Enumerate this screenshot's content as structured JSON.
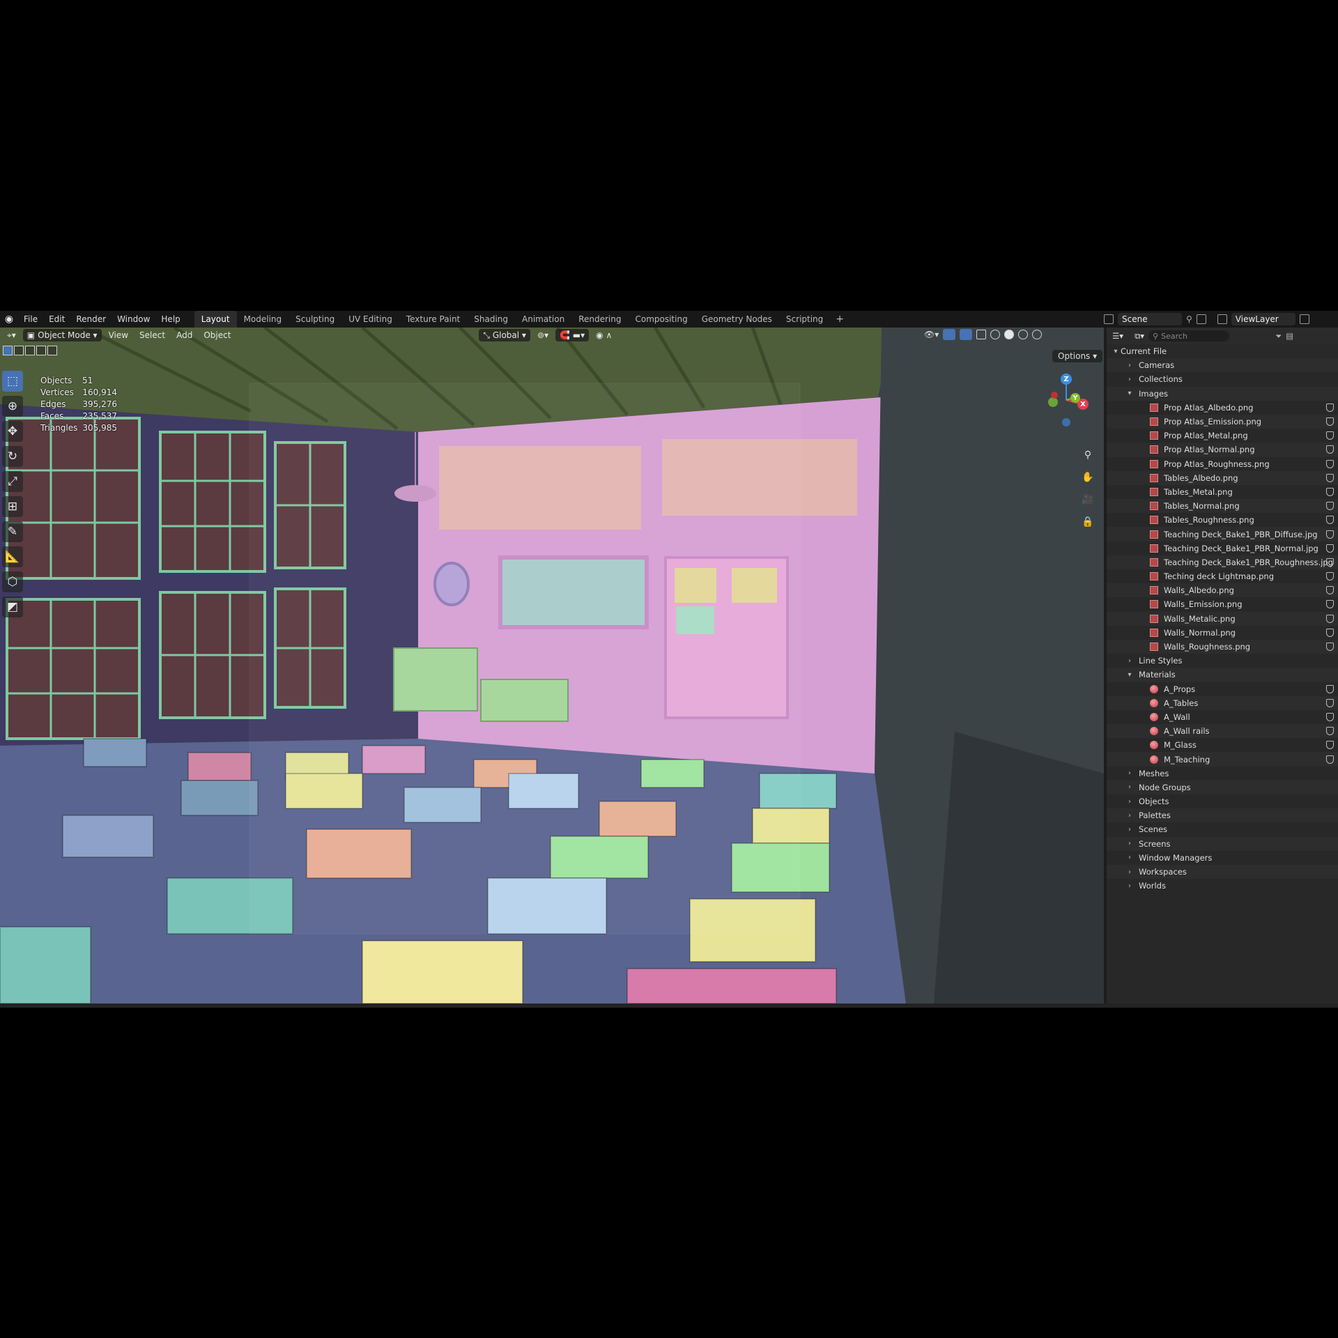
{
  "menu": [
    "File",
    "Edit",
    "Render",
    "Window",
    "Help"
  ],
  "workspaces": [
    "Layout",
    "Modeling",
    "Sculpting",
    "UV Editing",
    "Texture Paint",
    "Shading",
    "Animation",
    "Rendering",
    "Compositing",
    "Geometry Nodes",
    "Scripting"
  ],
  "active_workspace": "Layout",
  "scene_name": "Scene",
  "view_layer": "ViewLayer",
  "viewport": {
    "mode": "Object Mode",
    "menus": [
      "View",
      "Select",
      "Add",
      "Object"
    ],
    "orientation": "Global",
    "options_label": "Options",
    "stats": [
      {
        "label": "Objects",
        "value": "51"
      },
      {
        "label": "Vertices",
        "value": "160,914"
      },
      {
        "label": "Edges",
        "value": "395,276"
      },
      {
        "label": "Faces",
        "value": "235,537"
      },
      {
        "label": "Triangles",
        "value": "305,985"
      }
    ],
    "axes": {
      "z": "Z",
      "y": "Y",
      "x": "X"
    }
  },
  "outliner": {
    "search_placeholder": "Search",
    "root": "Current File",
    "rows": [
      {
        "label": "Cameras",
        "type": "group",
        "expanded": false
      },
      {
        "label": "Collections",
        "type": "group",
        "expanded": false
      },
      {
        "label": "Images",
        "type": "group",
        "expanded": true
      },
      {
        "label": "Prop Atlas_Albedo.png",
        "type": "image"
      },
      {
        "label": "Prop Atlas_Emission.png",
        "type": "image"
      },
      {
        "label": "Prop Atlas_Metal.png",
        "type": "image"
      },
      {
        "label": "Prop Atlas_Normal.png",
        "type": "image"
      },
      {
        "label": "Prop Atlas_Roughness.png",
        "type": "image"
      },
      {
        "label": "Tables_Albedo.png",
        "type": "image"
      },
      {
        "label": "Tables_Metal.png",
        "type": "image"
      },
      {
        "label": "Tables_Normal.png",
        "type": "image"
      },
      {
        "label": "Tables_Roughness.png",
        "type": "image"
      },
      {
        "label": "Teaching Deck_Bake1_PBR_Diffuse.jpg",
        "type": "image"
      },
      {
        "label": "Teaching Deck_Bake1_PBR_Normal.jpg",
        "type": "image"
      },
      {
        "label": "Teaching Deck_Bake1_PBR_Roughness.jpg",
        "type": "image"
      },
      {
        "label": "Teching deck Lightmap.png",
        "type": "image"
      },
      {
        "label": "Walls_Albedo.png",
        "type": "image"
      },
      {
        "label": "Walls_Emission.png",
        "type": "image"
      },
      {
        "label": "Walls_Metalic.png",
        "type": "image"
      },
      {
        "label": "Walls_Normal.png",
        "type": "image"
      },
      {
        "label": "Walls_Roughness.png",
        "type": "image"
      },
      {
        "label": "Line Styles",
        "type": "group",
        "expanded": false
      },
      {
        "label": "Materials",
        "type": "group",
        "expanded": true
      },
      {
        "label": "A_Props",
        "type": "material"
      },
      {
        "label": "A_Tables",
        "type": "material"
      },
      {
        "label": "A_Wall",
        "type": "material"
      },
      {
        "label": "A_Wall rails",
        "type": "material"
      },
      {
        "label": "M_Glass",
        "type": "material"
      },
      {
        "label": "M_Teaching",
        "type": "material"
      },
      {
        "label": "Meshes",
        "type": "group",
        "expanded": false
      },
      {
        "label": "Node Groups",
        "type": "group",
        "expanded": false
      },
      {
        "label": "Objects",
        "type": "group",
        "expanded": false
      },
      {
        "label": "Palettes",
        "type": "group",
        "expanded": false
      },
      {
        "label": "Scenes",
        "type": "group",
        "expanded": false
      },
      {
        "label": "Screens",
        "type": "group",
        "expanded": false
      },
      {
        "label": "Window Managers",
        "type": "group",
        "expanded": false
      },
      {
        "label": "Workspaces",
        "type": "group",
        "expanded": false
      },
      {
        "label": "Worlds",
        "type": "group",
        "expanded": false
      }
    ]
  },
  "colors": {
    "accent": "#4772b3",
    "axis_x": "#e0414f",
    "axis_y": "#7fbf2a",
    "axis_z": "#3a8ee6"
  }
}
